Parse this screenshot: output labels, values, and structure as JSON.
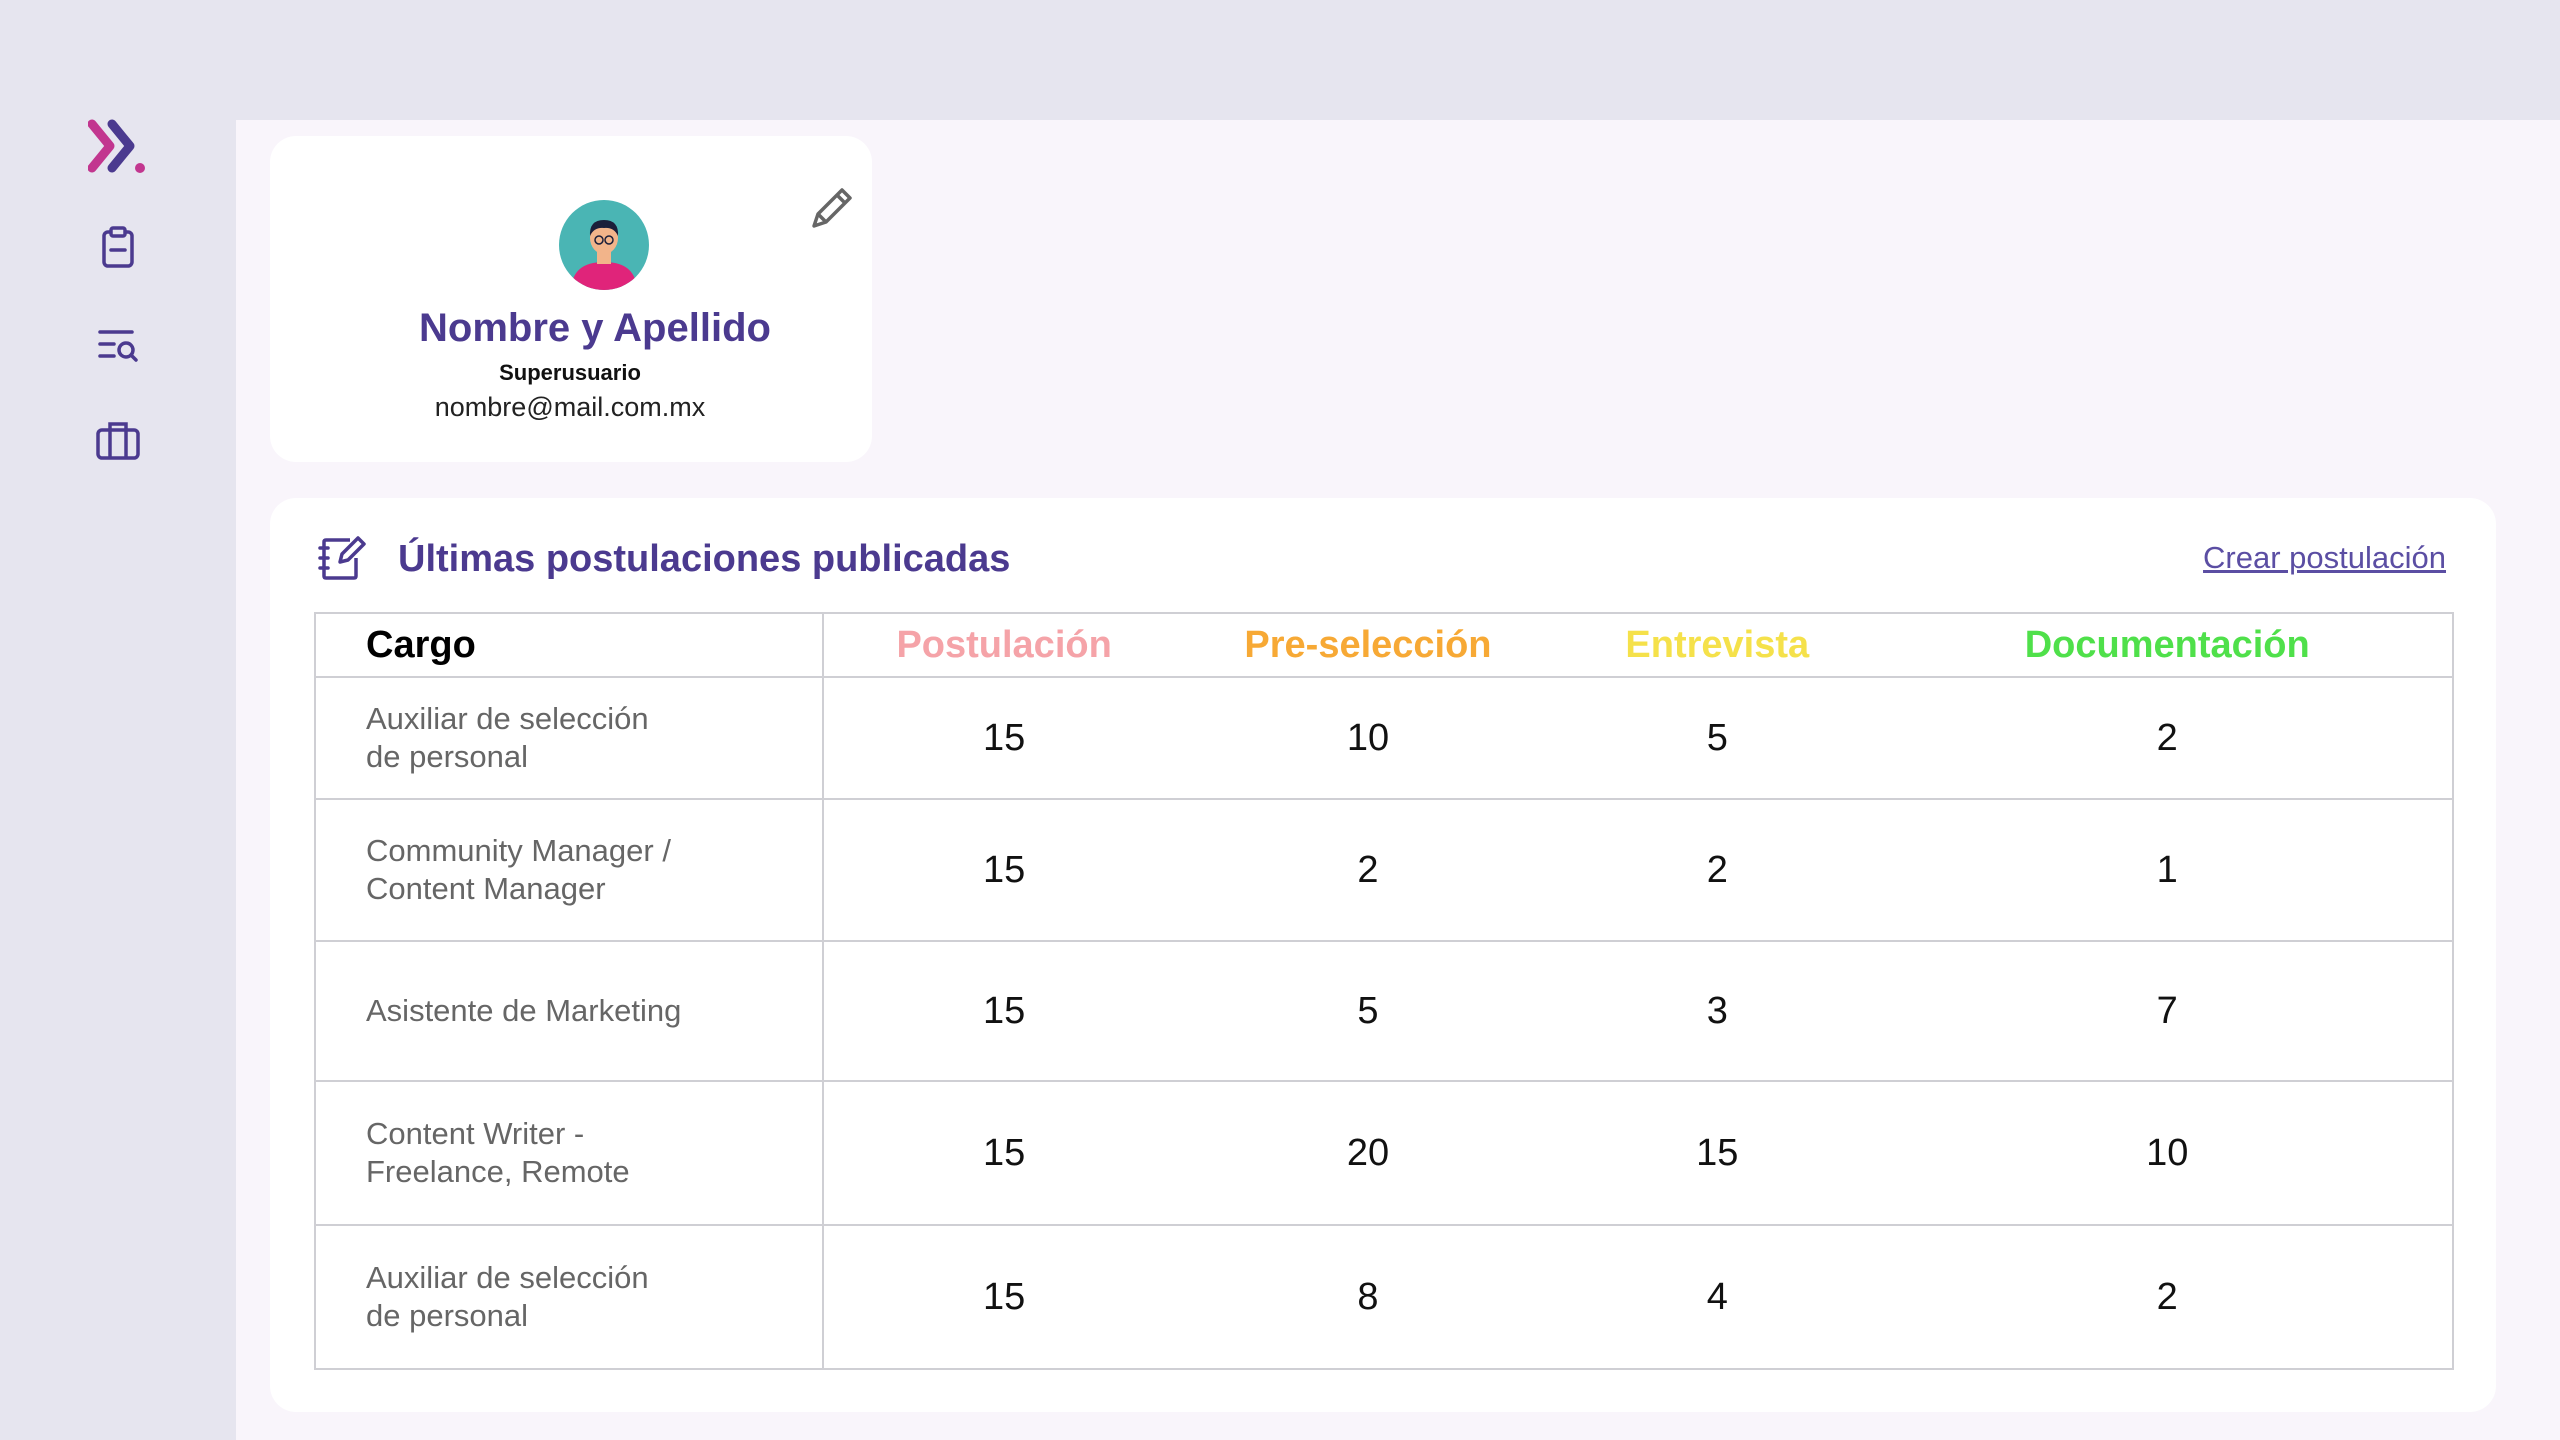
{
  "sidebar": {
    "logo_icon": "double-chevron-logo-icon",
    "items": [
      {
        "icon": "clipboard-icon"
      },
      {
        "icon": "search-list-icon"
      },
      {
        "icon": "briefcase-icon"
      }
    ]
  },
  "profile": {
    "name": "Nombre y Apellido",
    "role": "Superusuario",
    "email": "nombre@mail.com.mx",
    "edit_icon": "pencil-icon"
  },
  "postings": {
    "title": "Últimas postulaciones publicadas",
    "create_link": "Crear postulación",
    "columns": [
      {
        "label": "Cargo",
        "color": "#000000"
      },
      {
        "label": "Postulación",
        "color": "#f5a3a8"
      },
      {
        "label": "Pre-selección",
        "color": "#f7a935"
      },
      {
        "label": "Entrevista",
        "color": "#f5e14a"
      },
      {
        "label": "Documentación",
        "color": "#4fe04a"
      }
    ],
    "rows": [
      {
        "cargo": [
          "Auxiliar de selección",
          "de personal"
        ],
        "postulacion": "15",
        "preseleccion": "10",
        "entrevista": "5",
        "documentacion": "2"
      },
      {
        "cargo": [
          "Community Manager /",
          "Content Manager"
        ],
        "postulacion": "15",
        "preseleccion": "2",
        "entrevista": "2",
        "documentacion": "1"
      },
      {
        "cargo": [
          "Asistente de Marketing"
        ],
        "postulacion": "15",
        "preseleccion": "5",
        "entrevista": "3",
        "documentacion": "7"
      },
      {
        "cargo": [
          "Content Writer -",
          "Freelance, Remote"
        ],
        "postulacion": "15",
        "preseleccion": "20",
        "entrevista": "15",
        "documentacion": "10"
      },
      {
        "cargo": [
          "Auxiliar de selección",
          "de personal"
        ],
        "postulacion": "15",
        "preseleccion": "8",
        "entrevista": "4",
        "documentacion": "2"
      }
    ]
  },
  "colors": {
    "accent": "#4b3a8f",
    "logo_pink": "#c2368f",
    "sidebar_bg": "#e6e5ef",
    "main_bg": "#f9f5fb"
  }
}
